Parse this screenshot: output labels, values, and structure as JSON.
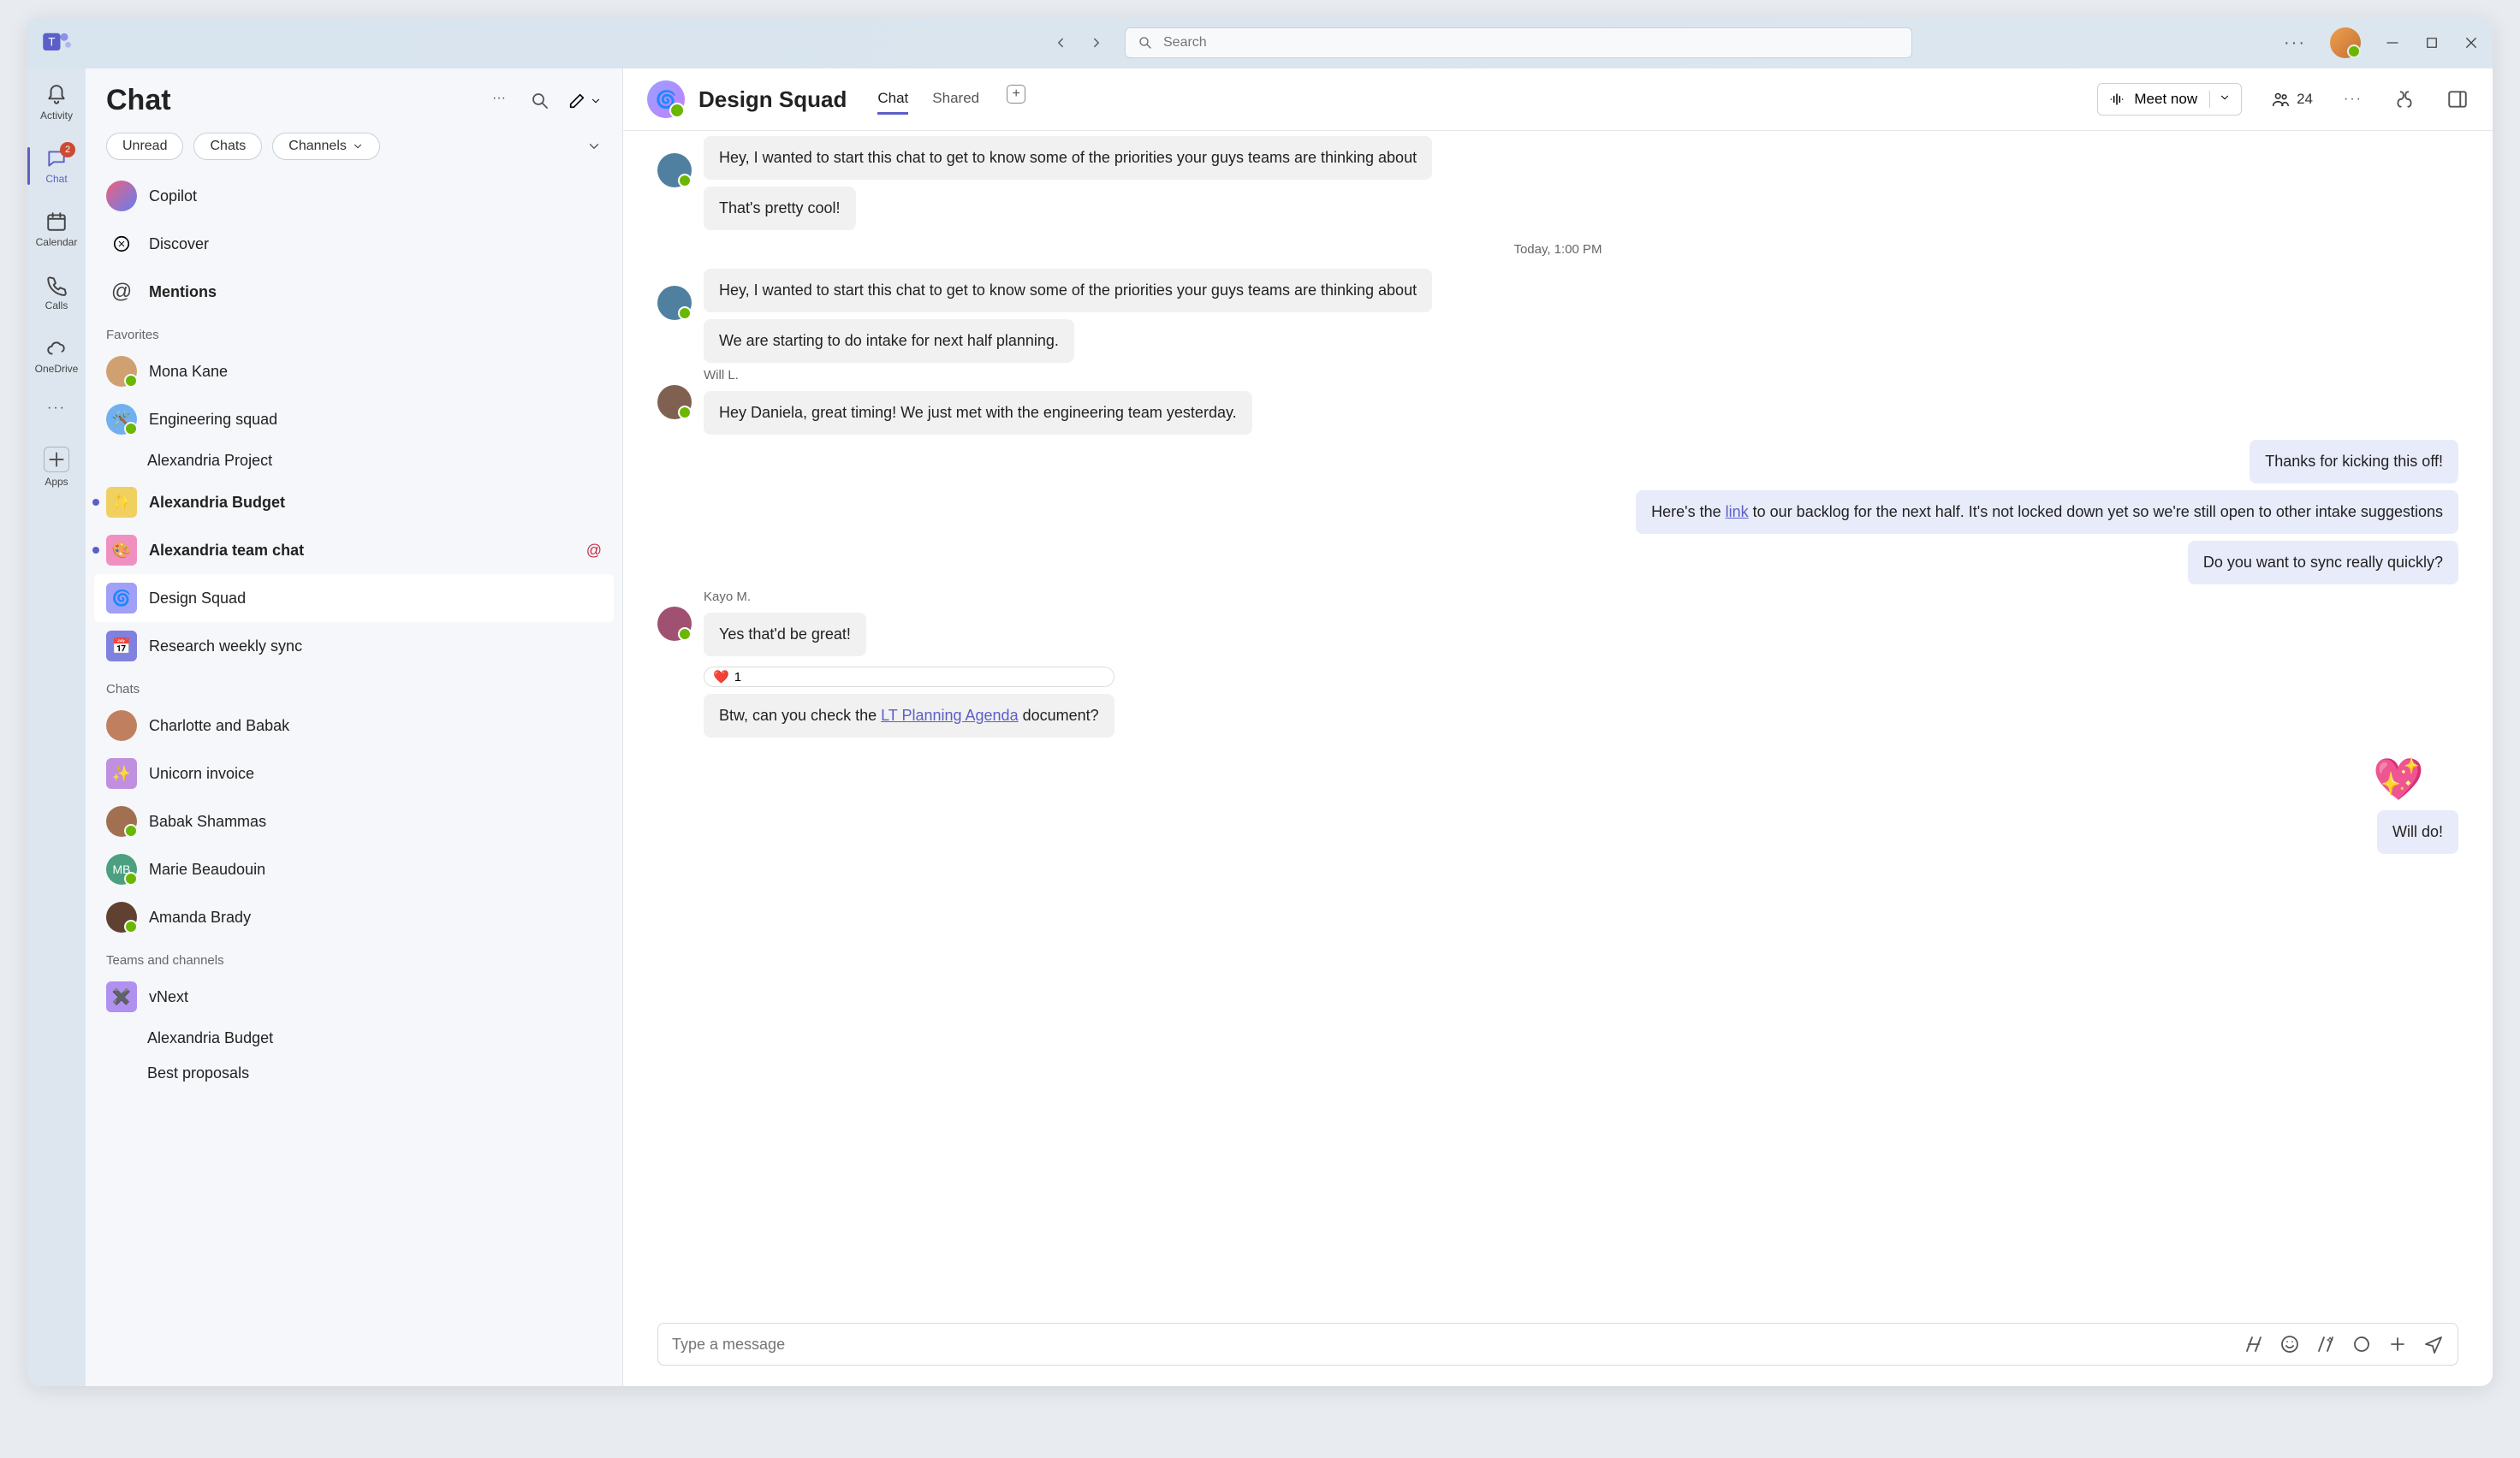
{
  "titlebar": {
    "search_placeholder": "Search"
  },
  "rail": {
    "items": [
      {
        "label": "Activity"
      },
      {
        "label": "Chat",
        "badge": "2"
      },
      {
        "label": "Calendar"
      },
      {
        "label": "Calls"
      },
      {
        "label": "OneDrive"
      }
    ],
    "more": "···",
    "apps_label": "Apps"
  },
  "sidebar": {
    "title": "Chat",
    "filters": {
      "unread": "Unread",
      "chats": "Chats",
      "channels": "Channels"
    },
    "top": [
      {
        "label": "Copilot"
      },
      {
        "label": "Discover"
      },
      {
        "label": "Mentions",
        "bold": true
      }
    ],
    "favorites_hdr": "Favorites",
    "favorites": [
      {
        "label": "Mona Kane",
        "avatar_bg": "#d0a070",
        "presence": true
      },
      {
        "label": "Engineering squad",
        "avatar_bg": "#70b0f0",
        "presence": true,
        "emoji": "🛠️"
      },
      {
        "label": "Alexandria Project",
        "indent": true
      },
      {
        "label": "Alexandria Budget",
        "bold": true,
        "dot": true,
        "avatar_bg": "#f0d060",
        "emoji": "✨"
      },
      {
        "label": "Alexandria team chat",
        "bold": true,
        "dot": true,
        "mention": "@",
        "avatar_bg": "#f090c0",
        "emoji": "🎨"
      },
      {
        "label": "Design Squad",
        "selected": true,
        "avatar_bg": "#a0a0f8",
        "emoji": "🌀"
      },
      {
        "label": "Research weekly sync",
        "avatar_bg": "#8080e0",
        "emoji": "📅"
      }
    ],
    "chats_hdr": "Chats",
    "chats": [
      {
        "label": "Charlotte and Babak",
        "avatar_bg": "#c08060"
      },
      {
        "label": "Unicorn invoice",
        "avatar_bg": "#c090e0",
        "emoji": "✨"
      },
      {
        "label": "Babak Shammas",
        "avatar_bg": "#a07050",
        "presence": true
      },
      {
        "label": "Marie Beaudouin",
        "avatar_bg": "#4aa080",
        "initials": "MB",
        "presence": true
      },
      {
        "label": "Amanda Brady",
        "avatar_bg": "#604030",
        "presence": true
      }
    ],
    "teams_hdr": "Teams and channels",
    "teams": [
      {
        "label": "vNext",
        "avatar_bg": "#b090f0",
        "emoji": "✖️"
      },
      {
        "label": "Alexandria Budget",
        "indent": true
      },
      {
        "label": "Best proposals",
        "indent": true
      }
    ]
  },
  "chatheader": {
    "title": "Design Squad",
    "tabs": {
      "chat": "Chat",
      "shared": "Shared"
    },
    "meet": "Meet now",
    "people_count": "24"
  },
  "messages": {
    "m0": "Hey, I wanted to start this chat to get to know some of the priorities your guys teams are thinking about",
    "m1": "That's pretty cool!",
    "divider": "Today, 1:00 PM",
    "m2": "Hey, I wanted to start this chat to get to know some of the priorities your guys teams are thinking about",
    "m3": "We are starting to do intake for next half planning.",
    "will_name": "Will L.",
    "m4": "Hey Daniela, great timing! We just met with the engineering team yesterday.",
    "m5": "Thanks for kicking this off!",
    "m6_a": "Here's the ",
    "m6_link": "link",
    "m6_b": " to our backlog for the next half. It's not locked down yet so we're still open to other intake suggestions",
    "m7": "Do you want to sync really quickly?",
    "kayo_name": "Kayo M.",
    "m8": "Yes that'd be great!",
    "reaction_count": "1",
    "m9_a": "Btw, can you check the ",
    "m9_link": "LT Planning Agenda",
    "m9_b": " document?",
    "m10": "Will do!"
  },
  "composer": {
    "placeholder": "Type a message"
  }
}
